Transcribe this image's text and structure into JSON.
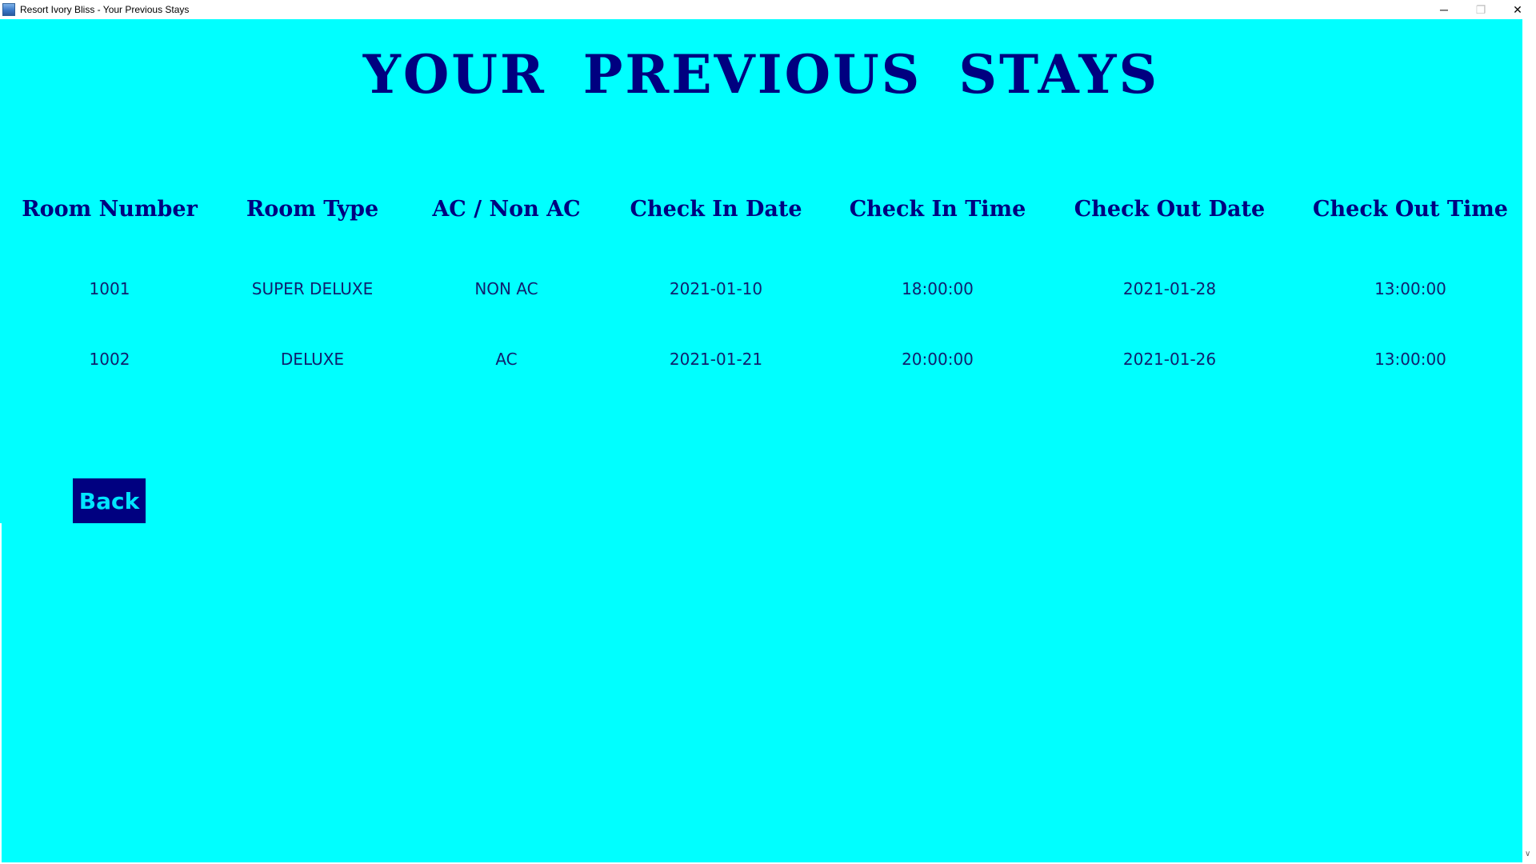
{
  "window": {
    "title": "Resort Ivory Bliss - Your Previous Stays",
    "controls": {
      "minimize": "─",
      "maximize": "❐",
      "close": "✕"
    }
  },
  "page": {
    "title": "YOUR  PREVIOUS  STAYS",
    "background_color": "#00ffff",
    "text_color": "#000080"
  },
  "table": {
    "headers": [
      "Room Number",
      "Room Type",
      "AC / Non AC",
      "Check In Date",
      "Check In Time",
      "Check Out Date",
      "Check Out Time"
    ],
    "rows": [
      [
        "1001",
        "SUPER DELUXE",
        "NON AC",
        "2021-01-10",
        "18:00:00",
        "2021-01-28",
        "13:00:00"
      ],
      [
        "1002",
        "DELUXE",
        "AC",
        "2021-01-21",
        "20:00:00",
        "2021-01-26",
        "13:00:00"
      ]
    ]
  },
  "actions": {
    "back_label": "Back"
  },
  "icons": {
    "app": "app-icon",
    "scroll_down": "chevron-down-icon"
  }
}
